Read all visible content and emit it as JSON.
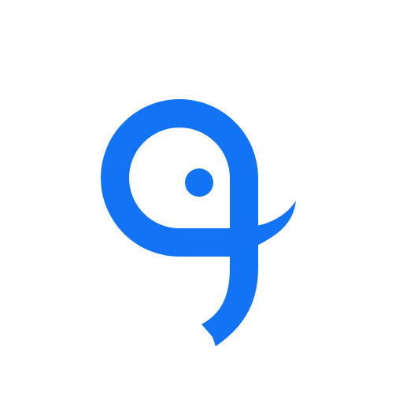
{
  "logo": {
    "icon": "stylized-q-eye-mark",
    "color": "#1273f5",
    "background": "#ffffff"
  }
}
